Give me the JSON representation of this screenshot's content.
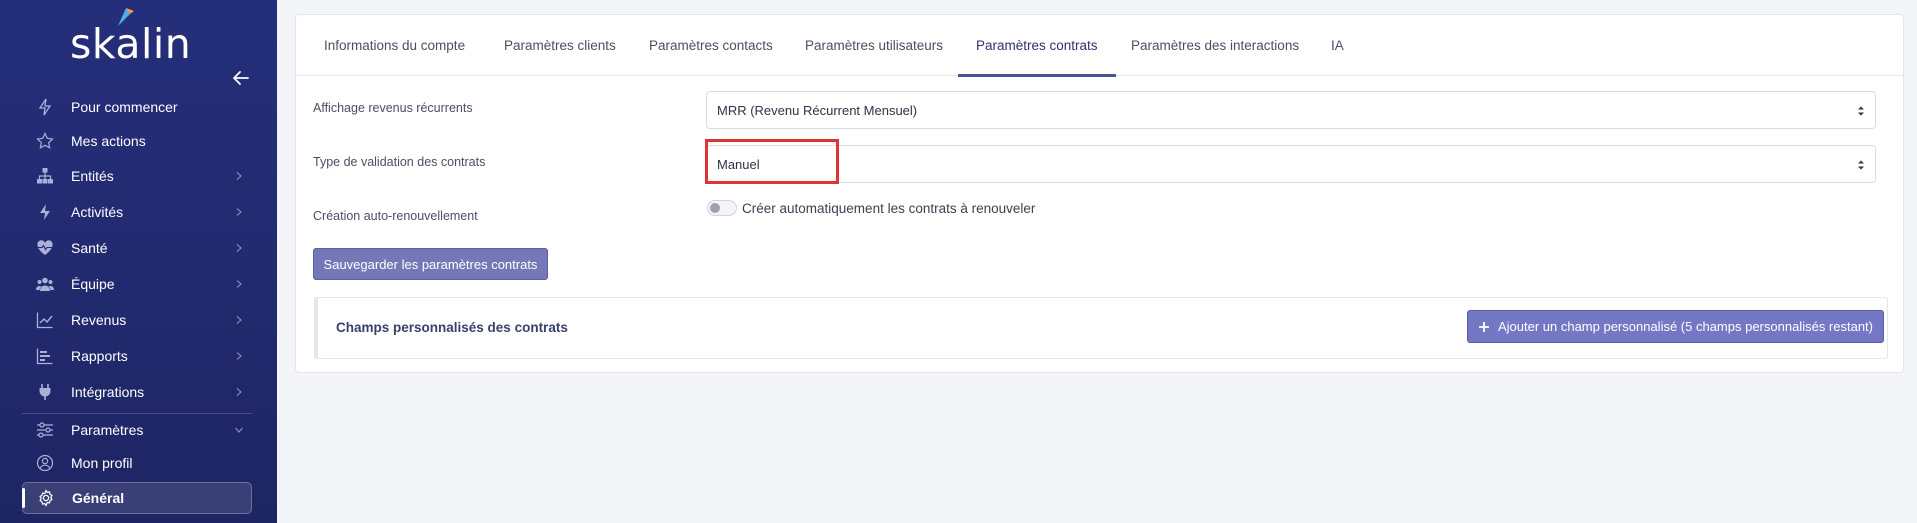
{
  "sidebar": {
    "logo_text": "skalin",
    "items": [
      {
        "label": "Pour commencer",
        "icon": "bolt-outline-icon"
      },
      {
        "label": "Mes actions",
        "icon": "star-icon"
      },
      {
        "label": "Entités",
        "icon": "hierarchy-icon"
      },
      {
        "label": "Activités",
        "icon": "bolt-icon"
      },
      {
        "label": "Santé",
        "icon": "heartbeat-icon"
      },
      {
        "label": "Équipe",
        "icon": "users-icon"
      },
      {
        "label": "Revenus",
        "icon": "line-chart-icon"
      },
      {
        "label": "Rapports",
        "icon": "bar-chart-icon"
      },
      {
        "label": "Intégrations",
        "icon": "plug-icon"
      },
      {
        "label": "Paramètres",
        "icon": "sliders-icon"
      },
      {
        "label": "Mon profil",
        "icon": "user-circle-icon"
      },
      {
        "label": "Général",
        "icon": "gear-icon"
      }
    ]
  },
  "tabs": [
    {
      "label": "Informations du compte"
    },
    {
      "label": "Paramètres clients"
    },
    {
      "label": "Paramètres contacts"
    },
    {
      "label": "Paramètres utilisateurs"
    },
    {
      "label": "Paramètres contrats",
      "active": true
    },
    {
      "label": "Paramètres des interactions"
    },
    {
      "label": "IA"
    }
  ],
  "form": {
    "recurring_label": "Affichage revenus récurrents",
    "recurring_value": "MRR (Revenu Récurrent Mensuel)",
    "validation_label": "Type de validation des contrats",
    "validation_value": "Manuel",
    "auto_renew_label": "Création auto-renouvellement",
    "auto_renew_toggle_label": "Créer automatiquement les contrats à renouveler",
    "auto_renew_enabled": false,
    "save_label": "Sauvegarder les paramètres contrats"
  },
  "custom_fields": {
    "title": "Champs personnalisés des contrats",
    "add_label": "Ajouter un champ personnalisé (5 champs personnalisés restant)"
  },
  "colors": {
    "sidebar": "#232b73",
    "accent": "#7478b6",
    "highlight": "#e03333"
  }
}
